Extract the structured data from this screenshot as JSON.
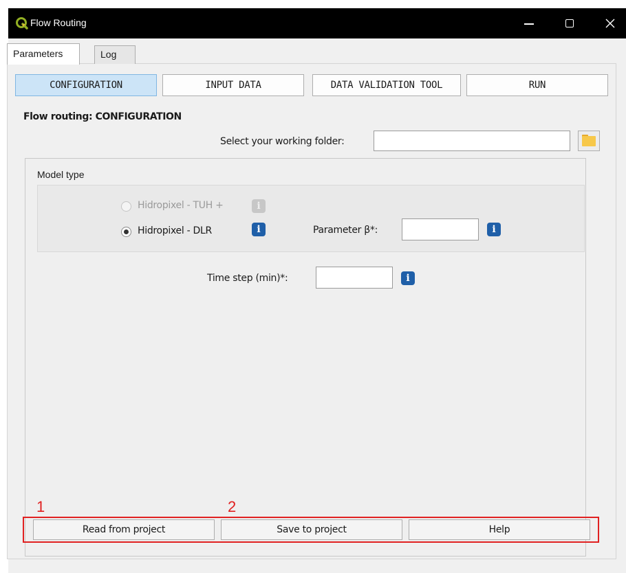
{
  "window": {
    "title": "Flow Routing",
    "app_icon": "qgis-icon",
    "controls": [
      "minimize-icon",
      "maximize-icon",
      "close-icon"
    ]
  },
  "tabs": [
    {
      "label": "Parameters",
      "active": true
    },
    {
      "label": "Log",
      "active": false
    }
  ],
  "nav": {
    "configuration": "CONFIGURATION",
    "input_data": "INPUT DATA",
    "data_validation": "DATA VALIDATION TOOL",
    "run": "RUN",
    "active": "CONFIGURATION"
  },
  "section_title": "Flow routing: CONFIGURATION",
  "working_folder": {
    "label": "Select your working folder:",
    "value": "",
    "browse_icon": "folder-icon"
  },
  "model_type": {
    "label": "Model type",
    "options": [
      {
        "label": "Hidropixel - TUH +",
        "selected": false,
        "enabled": false
      },
      {
        "label": "Hidropixel - DLR",
        "selected": true,
        "enabled": true
      }
    ],
    "parameter_beta": {
      "label": "Parameter β*:",
      "value": ""
    }
  },
  "time_step": {
    "label": "Time step (min)*:",
    "value": ""
  },
  "info_icon": "info-icon",
  "annotations": {
    "one": "1",
    "two": "2"
  },
  "buttons": {
    "read": "Read from project",
    "save": "Save to project",
    "help": "Help"
  },
  "colors": {
    "titlebar": "#000000",
    "active_nav": "#cce4f7",
    "info_blue": "#1f5fa8",
    "annotation_red": "#e02020",
    "folder_yellow": "#f7c84a"
  }
}
